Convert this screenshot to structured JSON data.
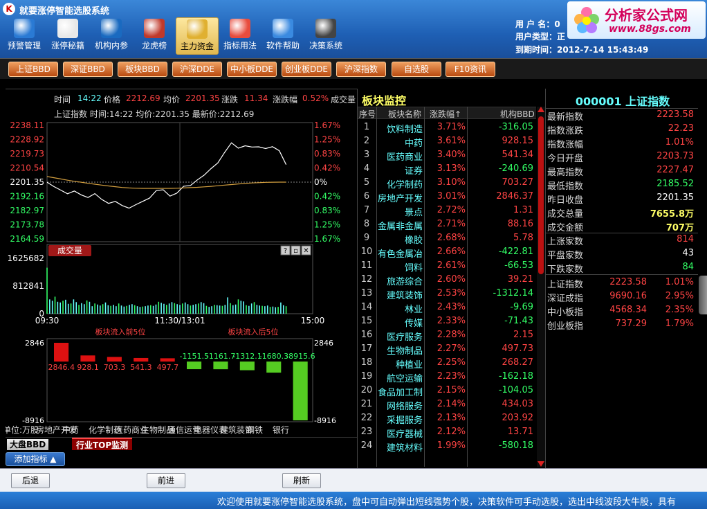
{
  "app": {
    "title": "就要涨停智能选股系统",
    "logo": "K"
  },
  "toolbar": [
    {
      "label": "预警管理",
      "icon": "monitor-icon",
      "color": "#2a7ad4"
    },
    {
      "label": "涨停秘籍",
      "icon": "newspaper-icon",
      "color": "#e8e8e8"
    },
    {
      "label": "机构内参",
      "icon": "globe-icon",
      "color": "#1a6ac0"
    },
    {
      "label": "龙虎榜",
      "icon": "building-icon",
      "color": "#c0392b"
    },
    {
      "label": "主力资金",
      "icon": "coins-icon",
      "color": "#e0b030"
    },
    {
      "label": "指标用法",
      "icon": "envelope-icon",
      "color": "#e84c3d"
    },
    {
      "label": "软件帮助",
      "icon": "help-globe-icon",
      "color": "#3a8ae0"
    },
    {
      "label": "决策系统",
      "icon": "calculator-icon",
      "color": "#444"
    }
  ],
  "toolbar_active_index": 4,
  "user": {
    "name_label": "用 户 名：",
    "name_value": "0",
    "type_label": "用户类型：",
    "type_value": "正",
    "expiry_label": "到期时间：",
    "expiry_value": "2012-7-14 15:43:49"
  },
  "brand": {
    "name": "分析家公式网",
    "url": "www.88gs.com"
  },
  "quickbar": [
    "上证BBD",
    "深证BBD",
    "板块BBD",
    "沪深DDE",
    "中小板DDE",
    "创业板DDE",
    "沪深指数",
    "自选股",
    "F10资讯"
  ],
  "info_bar": {
    "time_label": "时间",
    "time_value": "14:22",
    "price_label": "价格",
    "price_value": "2212.69",
    "avg_label": "均价",
    "avg_value": "2201.35",
    "change_label": "涨跌",
    "change_value": "11.34",
    "pct_label": "涨跌幅",
    "pct_value": "0.52%",
    "volume_label": "成交量"
  },
  "chart_data": [
    {
      "type": "line",
      "title": "上证指数 时间:14:22 均价:2201.35 最新价:2212.69",
      "y_ticks_left": [
        "2238.11",
        "2228.92",
        "2219.73",
        "2210.54",
        "2201.35",
        "2192.16",
        "2182.97",
        "2173.78",
        "2164.59"
      ],
      "y_ticks_right": [
        "1.67%",
        "1.25%",
        "0.83%",
        "0.42%",
        "0%",
        "0.42%",
        "0.83%",
        "1.25%",
        "1.67%"
      ],
      "ylim": [
        2164.59,
        2238.11
      ],
      "base": 2201.35,
      "series": [
        {
          "color": "#ffffff",
          "values": [
            2201.3,
            2198.5,
            2196.2,
            2193.8,
            2195.6,
            2193.1,
            2191.4,
            2193.9,
            2190.2,
            2187.6,
            2188.9,
            2186.2,
            2184.5,
            2186.8,
            2188.9,
            2191.0,
            2195.9,
            2196.4,
            2192.3,
            2194.2,
            2198.7,
            2199.2,
            2202.8,
            2205.9,
            2210.1,
            2213.8,
            2220.6,
            2226.8,
            2223.3,
            2224.9,
            2224.1,
            2224.2,
            2223.1,
            2224.3,
            2221.7,
            2212.7
          ]
        },
        {
          "color": "#d4a040",
          "values": [
            2205.0,
            2204.2,
            2203.4,
            2202.6,
            2201.9,
            2201.3,
            2200.6,
            2200.0,
            2199.4,
            2198.9,
            2198.4,
            2197.9,
            2197.6,
            2197.4,
            2197.3,
            2197.3,
            2197.3,
            2197.3,
            2197.3,
            2197.4,
            2197.6,
            2197.8,
            2198.0,
            2198.3,
            2198.6,
            2199.0,
            2199.4,
            2199.8,
            2200.2,
            2200.5,
            2200.8,
            2201.0,
            2201.2,
            2201.3,
            2201.35,
            2201.35
          ]
        }
      ]
    },
    {
      "type": "bar",
      "title": "成交量",
      "y_ticks": [
        "1625682",
        "812841",
        "0"
      ],
      "ylim": [
        0,
        1625682
      ],
      "x_ticks": [
        "09:30",
        "11:30/13:01",
        "15:00"
      ],
      "values": [
        1350000,
        420000,
        380000,
        500000,
        350000,
        330000,
        380000,
        410000,
        290000,
        300000,
        420000,
        340000,
        260000,
        310000,
        280000,
        390000,
        350000,
        220000,
        300000,
        270000,
        240000,
        280000,
        330000,
        250000,
        230000,
        260000,
        220000,
        300000,
        240000,
        210000,
        230000,
        260000,
        280000,
        250000,
        220000,
        200000,
        210000,
        220000,
        240000,
        250000,
        230000,
        270000,
        350000,
        320000,
        290000,
        260000,
        300000,
        340000,
        310000,
        280000,
        260000,
        300000,
        330000,
        280000,
        240000,
        260000,
        280000,
        300000,
        340000,
        310000,
        230000,
        200000,
        220000,
        260000,
        250000,
        240000,
        230000,
        260000,
        480000,
        310000,
        250000,
        270000,
        420000,
        380000,
        360000,
        250000,
        230000,
        300000,
        340000,
        260000,
        240000,
        230000,
        220000,
        240000,
        200000,
        210000,
        190000,
        200000,
        330000,
        250000,
        220000
      ]
    },
    {
      "type": "bar",
      "title_in": "板块流入前5位",
      "title_out": "板块流入后5位",
      "y_ticks": [
        "2846",
        "-8916"
      ],
      "ylim": [
        -8916,
        2846
      ],
      "categories": [
        "房地产开发",
        "中药",
        "化学制药",
        "医药商业",
        "生物制品",
        "通信运营",
        "电器仪表",
        "建筑装饰",
        "钢铁",
        "银行"
      ],
      "values": [
        2846.4,
        928.1,
        703.3,
        541.3,
        497.7,
        -1151.5,
        -1161.7,
        -1312.1,
        -1680.3,
        -8915.6
      ],
      "value_labels": [
        "2846.4",
        "928.1",
        "703.3",
        "541.3",
        "497.7",
        "-1151.5",
        "-1161.7",
        "-1312.1",
        "-1680.3",
        "-8915.6"
      ],
      "unit_text": "单位:万股"
    }
  ],
  "chart_controls": {
    "help": "?",
    "restore": "▫",
    "close": "✕"
  },
  "bottom_tabs": [
    "大盘BBD",
    "行业TOP监测"
  ],
  "add_indicator_label": "添加指标 ▲",
  "list": {
    "title": "板块监控",
    "headers": {
      "no": "序号",
      "name": "板块名称",
      "pct": "涨跌幅↑",
      "bbd": "机构BBD"
    },
    "rows": [
      {
        "no": "1",
        "name": "饮料制造",
        "pct": "3.71%",
        "bbd": "-316.05"
      },
      {
        "no": "2",
        "name": "中药",
        "pct": "3.61%",
        "bbd": "928.15"
      },
      {
        "no": "3",
        "name": "医药商业",
        "pct": "3.40%",
        "bbd": "541.34"
      },
      {
        "no": "4",
        "name": "证券",
        "pct": "3.13%",
        "bbd": "-240.69"
      },
      {
        "no": "5",
        "name": "化学制药",
        "pct": "3.10%",
        "bbd": "703.27"
      },
      {
        "no": "6",
        "name": "房地产开发",
        "pct": "3.01%",
        "bbd": "2846.37"
      },
      {
        "no": "7",
        "name": "景点",
        "pct": "2.72%",
        "bbd": "1.31"
      },
      {
        "no": "8",
        "name": "金属非金属",
        "pct": "2.71%",
        "bbd": "88.16"
      },
      {
        "no": "9",
        "name": "橡胶",
        "pct": "2.68%",
        "bbd": "5.78"
      },
      {
        "no": "10",
        "name": "有色金属冶",
        "pct": "2.66%",
        "bbd": "-422.81"
      },
      {
        "no": "11",
        "name": "饲料",
        "pct": "2.61%",
        "bbd": "-66.53"
      },
      {
        "no": "12",
        "name": "旅游综合",
        "pct": "2.60%",
        "bbd": "39.21"
      },
      {
        "no": "13",
        "name": "建筑装饰",
        "pct": "2.53%",
        "bbd": "-1312.14"
      },
      {
        "no": "14",
        "name": "林业",
        "pct": "2.43%",
        "bbd": "-9.69"
      },
      {
        "no": "15",
        "name": "传媒",
        "pct": "2.33%",
        "bbd": "-71.43"
      },
      {
        "no": "16",
        "name": "医疗服务",
        "pct": "2.28%",
        "bbd": "2.15"
      },
      {
        "no": "17",
        "name": "生物制品",
        "pct": "2.27%",
        "bbd": "497.73"
      },
      {
        "no": "18",
        "name": "种植业",
        "pct": "2.25%",
        "bbd": "268.27"
      },
      {
        "no": "19",
        "name": "航空运输",
        "pct": "2.23%",
        "bbd": "-162.18"
      },
      {
        "no": "20",
        "name": "食品加工制",
        "pct": "2.15%",
        "bbd": "-104.05"
      },
      {
        "no": "21",
        "name": "网络服务",
        "pct": "2.14%",
        "bbd": "434.03"
      },
      {
        "no": "22",
        "name": "采掘服务",
        "pct": "2.13%",
        "bbd": "203.92"
      },
      {
        "no": "23",
        "name": "医疗器械",
        "pct": "2.12%",
        "bbd": "13.71"
      },
      {
        "no": "24",
        "name": "建筑材料",
        "pct": "1.99%",
        "bbd": "-580.18"
      }
    ]
  },
  "quote": {
    "title": "000001 上证指数",
    "rows": [
      {
        "label": "最新指数",
        "value": "2223.58",
        "color": "#ff4444"
      },
      {
        "label": "指数涨跌",
        "value": "22.23",
        "color": "#ff4444"
      },
      {
        "label": "指数涨幅",
        "value": "1.01%",
        "color": "#ff4444"
      },
      {
        "label": "今日开盘",
        "value": "2203.73",
        "color": "#ff4444"
      },
      {
        "label": "最高指数",
        "value": "2227.47",
        "color": "#ff4444"
      },
      {
        "label": "最低指数",
        "value": "2185.52",
        "color": "#33ff66"
      },
      {
        "label": "昨日收盘",
        "value": "2201.35",
        "color": "#ffffff"
      },
      {
        "label": "成交总量",
        "value": "7655.8万",
        "color": "#ffff66"
      },
      {
        "label": "成交金额",
        "value": "707万",
        "color": "#ffff66"
      },
      {
        "label": "上涨家数",
        "value": "814",
        "color": "#ff4444"
      },
      {
        "label": "平盘家数",
        "value": "43",
        "color": "#ffffff"
      },
      {
        "label": "下跌家数",
        "value": "84",
        "color": "#33ff66"
      }
    ],
    "indices": [
      {
        "name": "上证指数",
        "value": "2223.58",
        "pct": "1.01%"
      },
      {
        "name": "深证成指",
        "value": "9690.16",
        "pct": "2.95%"
      },
      {
        "name": "中小板指",
        "value": "4568.34",
        "pct": "2.35%"
      },
      {
        "name": "创业板指",
        "value": "737.29",
        "pct": "1.79%"
      }
    ]
  },
  "buttons": {
    "back": "后退",
    "forward": "前进",
    "refresh": "刷新"
  },
  "status_text": "欢迎使用就要涨停智能选股系统，盘中可自动弹出短线强势个股，决策软件可手动选股，选出中线波段大牛股，具有"
}
